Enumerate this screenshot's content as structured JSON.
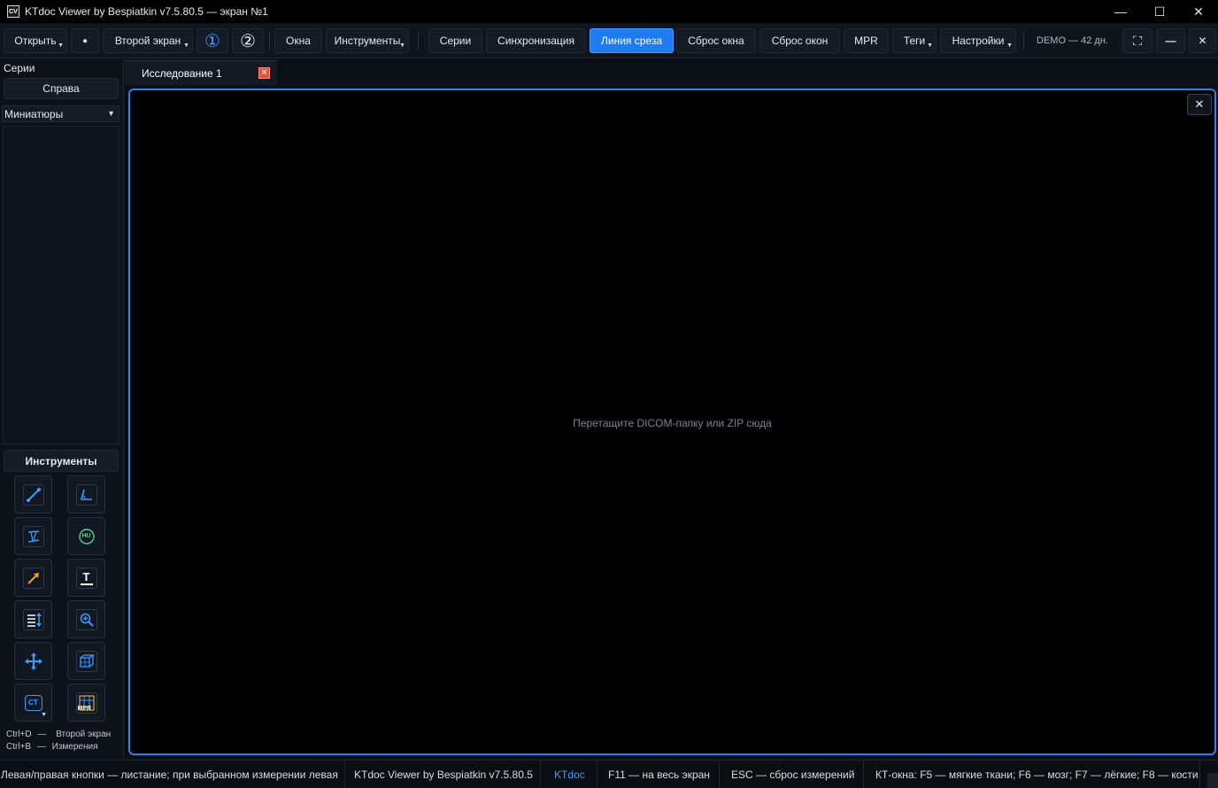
{
  "window": {
    "app_icon": "CV",
    "title": "KTdoc Viewer by Bespiatkin v7.5.80.5 — экран №1",
    "minimize": "—",
    "maximize": "☐",
    "close": "✕"
  },
  "toolbar": {
    "open": "Открыть",
    "second_screen": "Второй экран",
    "screen1": "①",
    "screen2": "②",
    "windows": "Окна",
    "tools": "Инструменты",
    "series": "Серии",
    "sync": "Синхронизация",
    "slice_line": "Линия среза",
    "reset_window": "Сброс окна",
    "reset_windows": "Сброс окон",
    "mpr": "MPR",
    "tags": "Теги",
    "settings": "Настройки",
    "demo": "DEMO — 42 дн.",
    "dropdown_glyph": "▼",
    "record_glyph": "●",
    "fullscreen_glyph": "⛶",
    "minimize_glyph": "—",
    "close_glyph": "✕"
  },
  "sidebar": {
    "series_title": "Серии",
    "position_button": "Справа",
    "view_select": "Миниатюры",
    "select_arrow": "▼",
    "tools_header": "Инструменты",
    "hints": [
      {
        "key": "Ctrl+D",
        "sep": "—",
        "action": "Второй экран"
      },
      {
        "key": "Ctrl+B",
        "sep": "—",
        "action": "Измерения"
      }
    ]
  },
  "tools": [
    {
      "icon": "line-measure-icon"
    },
    {
      "icon": "angle-icon"
    },
    {
      "icon": "cobb-angle-icon"
    },
    {
      "icon": "hu-density-icon",
      "text": "HU"
    },
    {
      "icon": "arrow-annotation-icon"
    },
    {
      "icon": "text-annotation-icon",
      "text": "T"
    },
    {
      "icon": "scroll-slices-icon"
    },
    {
      "icon": "zoom-icon"
    },
    {
      "icon": "pan-icon"
    },
    {
      "icon": "3d-cube-icon"
    },
    {
      "icon": "ct-window-icon",
      "text": "CT"
    },
    {
      "icon": "mpr-grid-icon",
      "text": "MPR"
    }
  ],
  "tab": {
    "label": "Исследование 1",
    "close": "✕"
  },
  "viewport": {
    "close": "✕",
    "drop_hint": "Перетащите DICOM-папку или ZIP сюда"
  },
  "statusbar": {
    "mouse_hint": "Левая/правая кнопки — листание; при выбранном измерении левая",
    "version": "KTdoc Viewer by Bespiatkin v7.5.80.5",
    "brand": "KTdoc",
    "fullscreen": "F11 — на весь экран",
    "esc": "ESC — сброс измерений",
    "ct_windows": "КТ-окна: F5 — мягкие ткани; F6 — мозг; F7 — лёгкие; F8 — кости"
  },
  "colors": {
    "accent": "#1e7bf0",
    "viewport_border": "#2b82ee",
    "tab_close": "#e0533f",
    "tool_icon": "#3d9bff"
  }
}
